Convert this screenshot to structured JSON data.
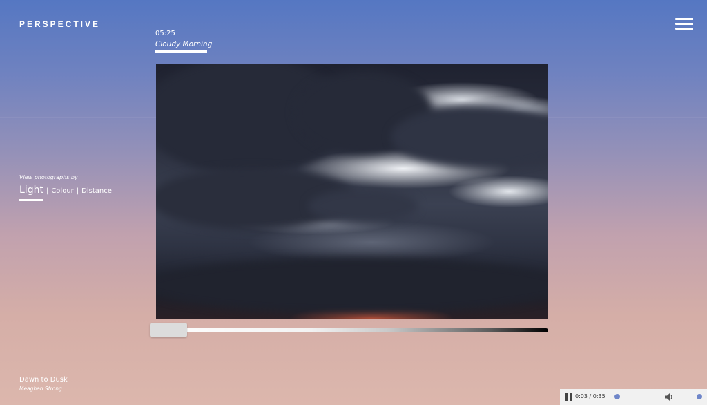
{
  "brand": {
    "logo": "PERSPECTIVE"
  },
  "photo": {
    "time": "05:25",
    "title": "Cloudy Morning"
  },
  "view": {
    "label": "View photographs by",
    "options": [
      "Light",
      "Colour",
      "Distance"
    ],
    "active": "Light",
    "separator": "|"
  },
  "light_slider": {
    "value_fraction": 0.0
  },
  "credits": {
    "album": "Dawn to Dusk",
    "artist": "Meaghan Strong"
  },
  "player": {
    "time_display": "0:03 / 0:35",
    "progress_fraction": 0.086,
    "volume_fraction": 1.0,
    "accent": "#6f86c9"
  },
  "icons": {
    "menu": "hamburger-icon",
    "pause": "pause-icon",
    "volume": "speaker-icon"
  }
}
